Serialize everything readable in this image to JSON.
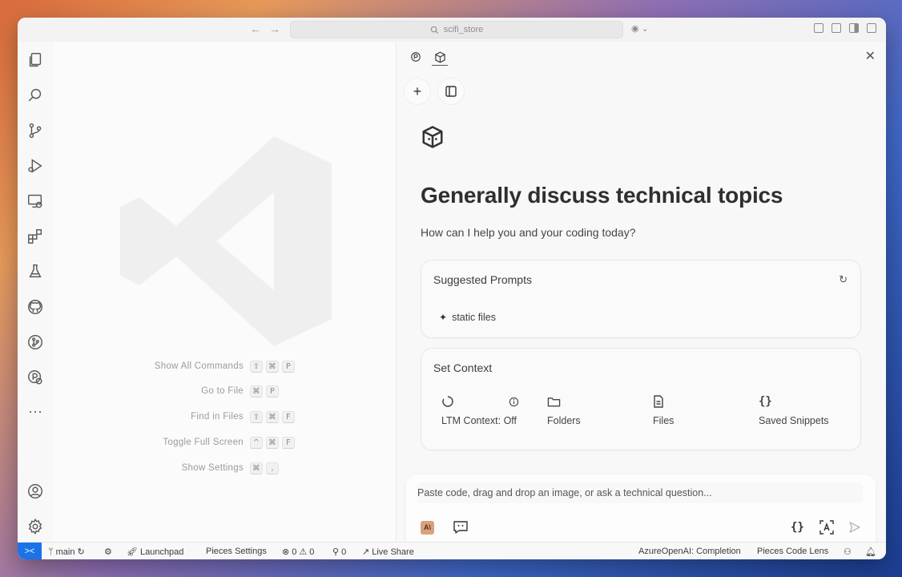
{
  "titlebar": {
    "search_text": "scifi_store"
  },
  "editor": {
    "shortcuts": [
      {
        "label": "Show All Commands",
        "keys": [
          "⇧",
          "⌘",
          "P"
        ]
      },
      {
        "label": "Go to File",
        "keys": [
          "⌘",
          "P"
        ]
      },
      {
        "label": "Find in Files",
        "keys": [
          "⇧",
          "⌘",
          "F"
        ]
      },
      {
        "label": "Toggle Full Screen",
        "keys": [
          "^",
          "⌘",
          "F"
        ]
      },
      {
        "label": "Show Settings",
        "keys": [
          "⌘",
          ","
        ]
      }
    ]
  },
  "panel": {
    "title": "Generally discuss technical topics",
    "subtitle": "How can I help you and your coding today?",
    "suggested": {
      "title": "Suggested Prompts",
      "items": [
        "static files"
      ]
    },
    "context": {
      "title": "Set Context",
      "items": [
        "LTM Context: Off",
        "Folders",
        "Files",
        "Saved Snippets"
      ]
    },
    "chat": {
      "placeholder": "Paste code, drag and drop an image, or ask a technical question..."
    }
  },
  "statusbar": {
    "branch": "main",
    "launchpad": "Launchpad",
    "pieces_settings": "Pieces Settings",
    "errors": "0",
    "warnings": "0",
    "ports": "0",
    "live_share": "Live Share",
    "model": "AzureOpenAI: Completion",
    "code_lens": "Pieces Code Lens"
  },
  "colors": {
    "accent": "#1a73e8",
    "ai_badge": "#d9a27c"
  }
}
